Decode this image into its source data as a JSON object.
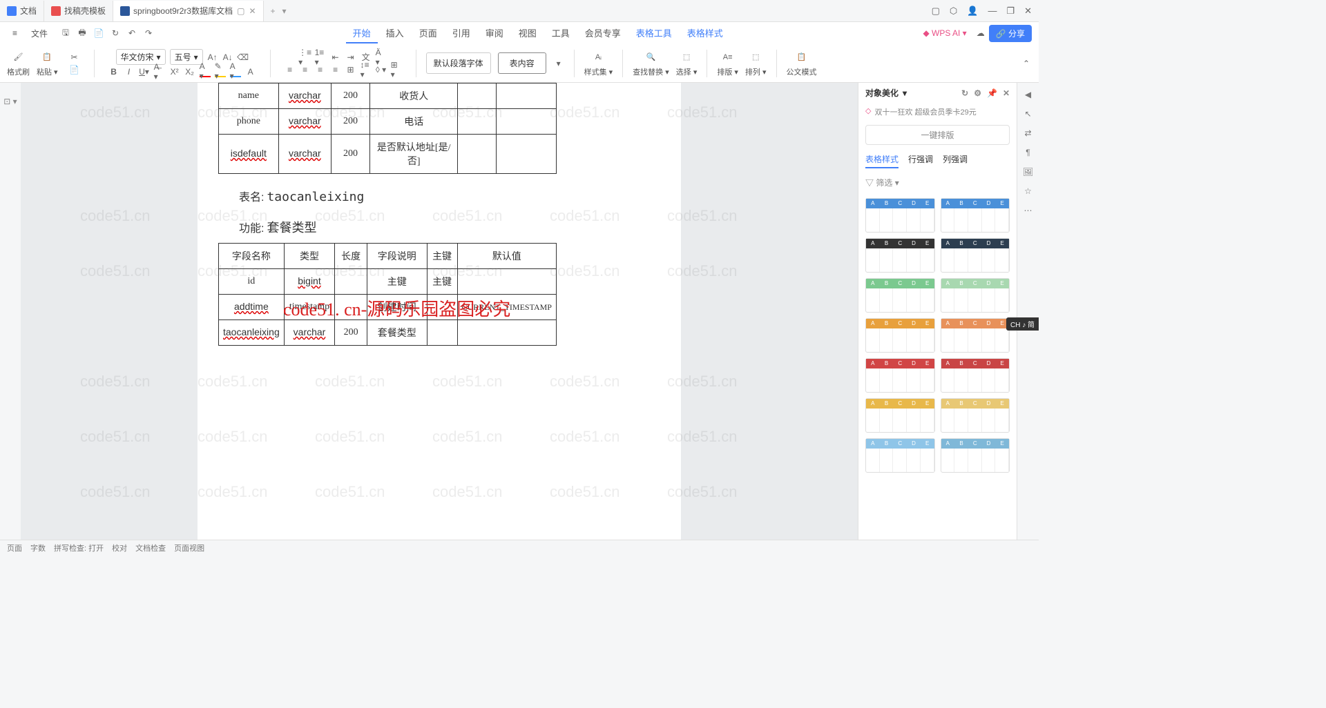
{
  "tabs": [
    "文档",
    "找稿壳模板",
    "springboot9r2r3数据库文档"
  ],
  "win_ctrls": [
    "▢",
    "⬡",
    "👤",
    "—",
    "❐",
    "✕"
  ],
  "file_label": "文件",
  "ribbon_tabs": [
    "开始",
    "插入",
    "页面",
    "引用",
    "审阅",
    "视图",
    "工具",
    "会员专享",
    "表格工具",
    "表格样式"
  ],
  "wpsai": "WPS AI",
  "share": "分享",
  "toolbar": {
    "brush": "格式刷",
    "paste": "粘贴",
    "font": "华文仿宋",
    "size": "五号",
    "default_font": "默认段落字体",
    "content": "表内容",
    "style_set": "样式集",
    "find": "查找替换",
    "select": "选择",
    "row_ht": "排版",
    "sort": "排列",
    "form": "公文模式"
  },
  "table1": {
    "rows": [
      {
        "c0": "name",
        "c1": "varchar",
        "c2": "200",
        "c3": "收货人",
        "c4": "",
        "c5": ""
      },
      {
        "c0": "phone",
        "c1": "varchar",
        "c2": "200",
        "c3": "电话",
        "c4": "",
        "c5": ""
      },
      {
        "c0": "isdefault",
        "c1": "varchar",
        "c2": "200",
        "c3": "是否默认地址[是/否]",
        "c4": "",
        "c5": ""
      }
    ]
  },
  "section": {
    "name_lbl": "表名:",
    "name_val": "taocanleixing",
    "func_lbl": "功能:",
    "func_val": "套餐类型"
  },
  "table2": {
    "headers": [
      "字段名称",
      "类型",
      "长度",
      "字段说明",
      "主键",
      "默认值"
    ],
    "rows": [
      {
        "c0": "id",
        "c1": "bigint",
        "c2": "",
        "c3": "主键",
        "c4": "主键",
        "c5": ""
      },
      {
        "c0": "addtime",
        "c1": "timestamp",
        "c2": "",
        "c3": "创建时间",
        "c4": "",
        "c5": "CURRENT_TIMESTAMP"
      },
      {
        "c0": "taocanleixing",
        "c1": "varchar",
        "c2": "200",
        "c3": "套餐类型",
        "c4": "",
        "c5": ""
      }
    ]
  },
  "red_text": "code51. cn-源码乐园盗图必究",
  "watermark": "code51.cn",
  "rpanel": {
    "title": "对象美化",
    "promo": "双十一狂欢 超级会员季卡29元",
    "onekey": "一键排版",
    "subtabs": [
      "表格样式",
      "行强调",
      "列强调"
    ],
    "filter": "筛选",
    "style_colors": [
      "#4a90d9",
      "#4a90d9",
      "#333333",
      "#2c3e50",
      "#7bc98f",
      "#a8d8b0",
      "#e8a03c",
      "#e8915a",
      "#d14545",
      "#c94545",
      "#e8b84a",
      "#e8c874",
      "#8fc5e8",
      "#7fb8d8"
    ]
  },
  "ime": "CH ♪ 简",
  "status": {
    "items": [
      "页面",
      "字数",
      "拼写检查: 打开",
      "校对",
      "文档检查",
      "页面视图"
    ]
  }
}
